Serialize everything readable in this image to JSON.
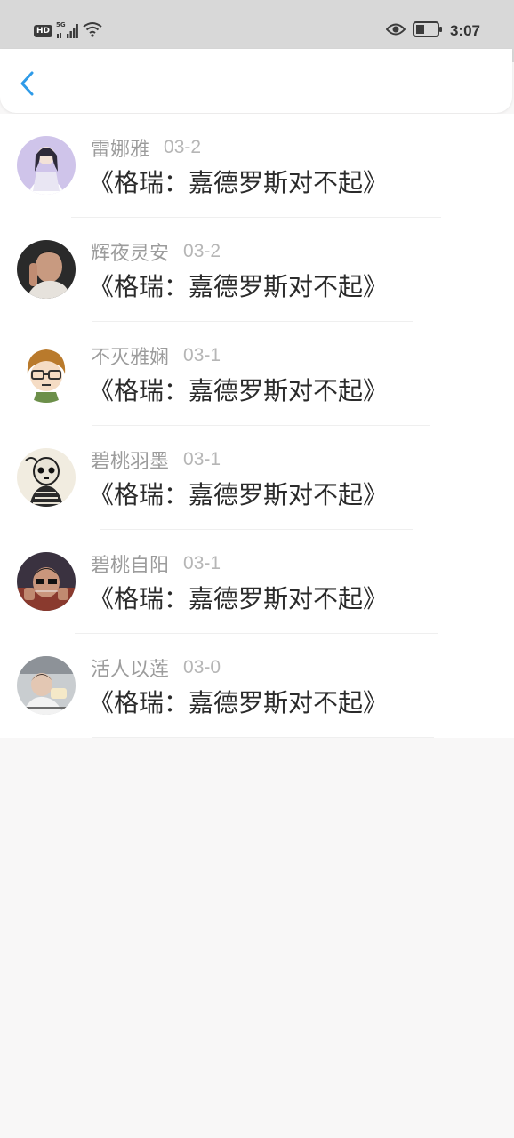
{
  "status_bar": {
    "hd": "HD",
    "network": "5G",
    "network_sub": "1l",
    "time": "3:07"
  },
  "header": {
    "back_icon": "chevron-left-icon",
    "accent_color": "#2f9be8"
  },
  "items": [
    {
      "name": "雷娜雅",
      "date": "03-2",
      "title": "《格瑞：嘉德罗斯对不起》"
    },
    {
      "name": "辉夜灵安",
      "date": "03-2",
      "title": "《格瑞：嘉德罗斯对不起》"
    },
    {
      "name": "不灭雅娴",
      "date": "03-1",
      "title": "《格瑞：嘉德罗斯对不起》"
    },
    {
      "name": "碧桃羽墨",
      "date": "03-1",
      "title": "《格瑞：嘉德罗斯对不起》"
    },
    {
      "name": "碧桃自阳",
      "date": "03-1",
      "title": "《格瑞：嘉德罗斯对不起》"
    },
    {
      "name": "活人以莲",
      "date": "03-0",
      "title": "《格瑞：嘉德罗斯对不起》"
    }
  ]
}
